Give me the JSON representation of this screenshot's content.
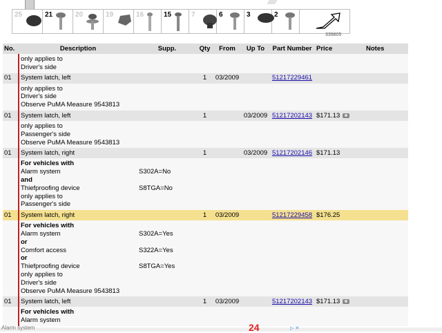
{
  "legend": {
    "items": [
      {
        "num": "25",
        "muted": true,
        "icon": "round-cap"
      },
      {
        "num": "21",
        "muted": false,
        "icon": "screw"
      },
      {
        "num": "20",
        "muted": true,
        "icon": "screw-washer"
      },
      {
        "num": "19",
        "muted": true,
        "icon": "clip"
      },
      {
        "num": "16",
        "muted": true,
        "icon": "pin"
      },
      {
        "num": "15",
        "muted": false,
        "icon": "bolt"
      },
      {
        "num": "7",
        "muted": true,
        "icon": "plug"
      },
      {
        "num": "6",
        "muted": false,
        "icon": "screw"
      },
      {
        "num": "3",
        "muted": false,
        "icon": "grommet"
      },
      {
        "num": "2",
        "muted": false,
        "icon": "screw"
      },
      {
        "num": "",
        "muted": false,
        "icon": "direction-arrow"
      }
    ],
    "image_id": "339805"
  },
  "table": {
    "headers": {
      "no": "No.",
      "desc": "Description",
      "supp": "Supp.",
      "qty": "Qty",
      "from": "From",
      "upto": "Up To",
      "part": "Part Number",
      "price": "Price",
      "notes": "Notes"
    },
    "rows": [
      {
        "type": "info",
        "lines": [
          {
            "t": "only applies to"
          },
          {
            "t": "Driver's side"
          }
        ]
      },
      {
        "type": "part",
        "no": "01",
        "desc": "System latch, left",
        "qty": "1",
        "from": "03/2009",
        "upto": "",
        "part": "51217229461",
        "price": "",
        "cam": false
      },
      {
        "type": "info",
        "lines": [
          {
            "t": "only applies to"
          },
          {
            "t": "Driver's side"
          },
          {
            "t": "Observe PuMA Measure 9543813"
          }
        ]
      },
      {
        "type": "part",
        "no": "01",
        "desc": "System latch, left",
        "qty": "1",
        "from": "",
        "upto": "03/2009",
        "part": "51217202143",
        "price": "$171.13",
        "cam": true
      },
      {
        "type": "info",
        "lines": [
          {
            "t": "only applies to"
          },
          {
            "t": "Passenger's side"
          },
          {
            "t": "Observe PuMA Measure 9543813"
          }
        ]
      },
      {
        "type": "part",
        "no": "01",
        "desc": "System latch, right",
        "qty": "1",
        "from": "",
        "upto": "03/2009",
        "part": "51217202146",
        "price": "$171.13",
        "cam": false
      },
      {
        "type": "info",
        "lines": [
          {
            "t": "For vehicles with",
            "b": true
          },
          {
            "t": "Alarm system",
            "s": "S302A=No"
          },
          {
            "t": "and",
            "b": true
          },
          {
            "t": "Thiefproofing device",
            "s": "S8TGA=No"
          },
          {
            "t": "only applies to"
          },
          {
            "t": "Passenger's side"
          }
        ]
      },
      {
        "type": "part",
        "hl": true,
        "no": "01",
        "desc": "System latch, right",
        "qty": "1",
        "from": "03/2009",
        "upto": "",
        "part": "51217229458",
        "price": "$176.25",
        "cam": false
      },
      {
        "type": "info",
        "lines": [
          {
            "t": "For vehicles with",
            "b": true
          },
          {
            "t": "Alarm system",
            "s": "S302A=Yes"
          },
          {
            "t": "or",
            "b": true
          },
          {
            "t": "Comfort access",
            "s": "S322A=Yes"
          },
          {
            "t": "or",
            "b": true
          },
          {
            "t": "Thiefproofing device",
            "s": "S8TGA=Yes"
          },
          {
            "t": "only applies to"
          },
          {
            "t": "Driver's side"
          },
          {
            "t": "Observe PuMA Measure 9543813"
          }
        ]
      },
      {
        "type": "part",
        "no": "01",
        "desc": "System latch, left",
        "qty": "1",
        "from": "03/2009",
        "upto": "",
        "part": "51217202143",
        "price": "$171.13",
        "cam": true
      },
      {
        "type": "info",
        "lines": [
          {
            "t": "For vehicles with",
            "b": true
          },
          {
            "t": "Alarm system"
          }
        ]
      }
    ]
  },
  "ad": {
    "text": "Alarm system",
    "brand": "24"
  }
}
